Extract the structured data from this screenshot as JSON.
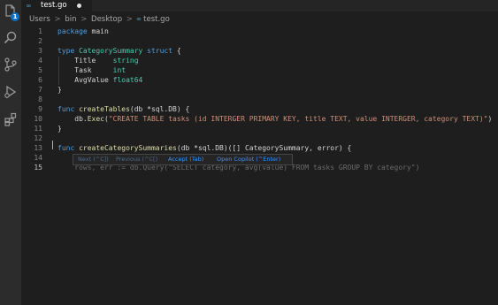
{
  "activity_bar": {
    "explorer_badge": "1",
    "icons": [
      "explorer-icon",
      "search-icon",
      "source-control-icon",
      "run-debug-icon",
      "extensions-icon"
    ]
  },
  "tab": {
    "icon": "∞",
    "label": "test.go"
  },
  "breadcrumb": {
    "items": [
      "Users",
      "bin",
      "Desktop",
      "test.go"
    ],
    "separator": ">",
    "file_icon": "∞"
  },
  "editor": {
    "line_numbers": [
      "1",
      "2",
      "3",
      "4",
      "5",
      "6",
      "7",
      "8",
      "9",
      "10",
      "11",
      "12",
      "13",
      "14",
      "15"
    ],
    "active_line": "15",
    "lines": {
      "l1": [
        {
          "t": "package",
          "c": "kw"
        },
        {
          "t": " main",
          "c": "pl"
        }
      ],
      "l3": [
        {
          "t": "type ",
          "c": "kw"
        },
        {
          "t": "CategorySummary",
          "c": "ty"
        },
        {
          "t": " struct",
          "c": "kw"
        },
        {
          "t": " {",
          "c": "pl"
        }
      ],
      "l4": [
        {
          "t": "    Title    ",
          "c": "fld"
        },
        {
          "t": "string",
          "c": "ty"
        }
      ],
      "l5": [
        {
          "t": "    Task     ",
          "c": "fld"
        },
        {
          "t": "int",
          "c": "ty"
        }
      ],
      "l6": [
        {
          "t": "    AvgValue ",
          "c": "fld"
        },
        {
          "t": "float64",
          "c": "ty"
        }
      ],
      "l7": [
        {
          "t": "}",
          "c": "pl"
        }
      ],
      "l9": [
        {
          "t": "func ",
          "c": "kw"
        },
        {
          "t": "createTables",
          "c": "fn"
        },
        {
          "t": "(db *sql.DB) {",
          "c": "pl"
        }
      ],
      "l10": [
        {
          "t": "    db.",
          "c": "pl"
        },
        {
          "t": "Exec",
          "c": "fn"
        },
        {
          "t": "(",
          "c": "pl"
        },
        {
          "t": "\"CREATE TABLE tasks (id INTERGER PRIMARY KEY, title TEXT, value INTERGER, category TEXT)\"",
          "c": "str"
        },
        {
          "t": ")",
          "c": "pl"
        }
      ],
      "l11": [
        {
          "t": "}",
          "c": "pl"
        }
      ],
      "l13": [
        {
          "t": "func ",
          "c": "kw"
        },
        {
          "t": "createCategorySummaries",
          "c": "fn"
        },
        {
          "t": "(db *sql.DB)([] CategorySummary, error) {",
          "c": "pl"
        }
      ],
      "l15": [
        {
          "t": "    rows, err := db.Query(\"SELECT category, avg(value) FROM tasks GROUP BY category\")",
          "c": "ghost"
        }
      ]
    }
  },
  "suggestion_bar": {
    "next": "Next (^C])",
    "previous": "Previous (^C[)",
    "accept": "Accept (Tab)",
    "open_copilot": "Open Copilot (^Enter)"
  }
}
